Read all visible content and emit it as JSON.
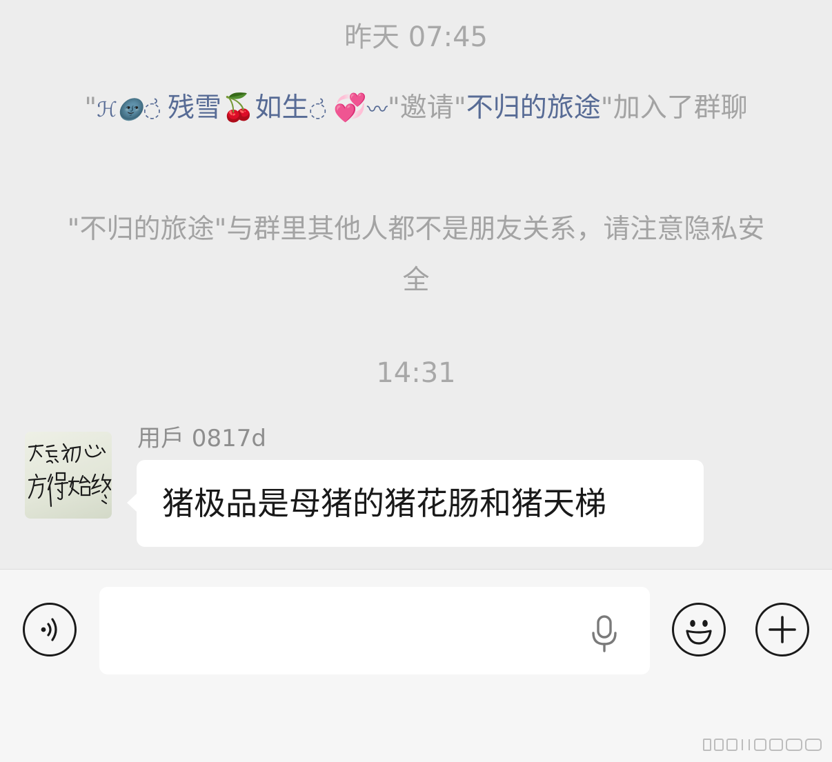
{
  "chat": {
    "timestamp_1": "昨天 07:45",
    "system_invite": {
      "quote_open": "\"",
      "inviter_fancy": "ℋ🌚",
      "inviter_deco1": "◌͗ ",
      "inviter_part1": "残雪",
      "cherry": "🍒",
      "inviter_part2": "如生",
      "inviter_deco2": "◌͗ ",
      "hearts": "💞",
      "swirl": "〰",
      "invite_word": "\"邀请\"",
      "invitee": "不归的旅途",
      "tail": "\"加入了群聊"
    },
    "system_privacy": "\"不归的旅途\"与群里其他人都不是朋友关系，请注意隐私安全",
    "timestamp_2": "14:31",
    "message": {
      "sender": "用戶 0817d",
      "avatar_alt": "不忘初心 方得始终",
      "text": "猪极品是母猪的猪花肠和猪天梯"
    }
  },
  "input_bar": {
    "placeholder": "",
    "voice_icon": "voice-mode-icon",
    "mic_icon": "microphone-icon",
    "emoji_icon": "emoji-icon",
    "plus_icon": "plus-icon"
  }
}
